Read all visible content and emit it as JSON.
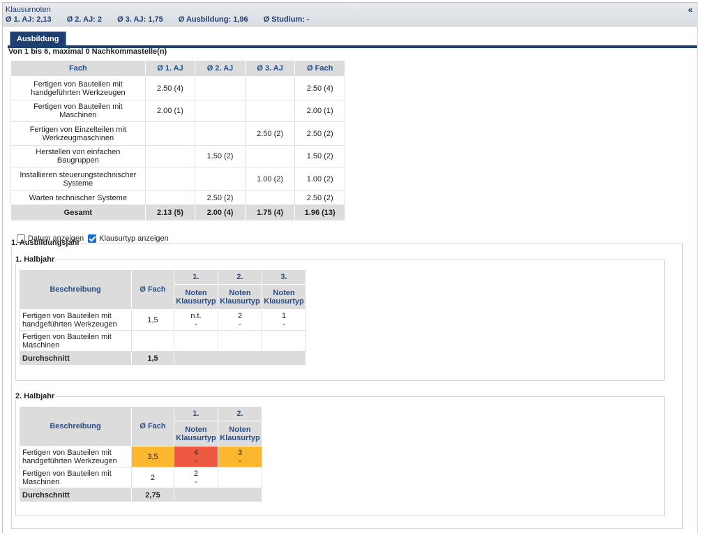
{
  "header": {
    "title": "Klausurnoten",
    "collapse": "«",
    "stats": [
      "Ø 1. AJ: 2,13",
      "Ø 2. AJ: 2",
      "Ø 3. AJ: 1,75",
      "Ø Ausbildung: 1,96",
      "Ø Studium: -"
    ]
  },
  "tab": {
    "label": "Ausbildung"
  },
  "range_note": "Von 1 bis 6, maximal 0 Nachkommastelle(n)",
  "summary": {
    "headers": [
      "Fach",
      "Ø 1. AJ",
      "Ø 2. AJ",
      "Ø 3. AJ",
      "Ø Fach"
    ],
    "rows": [
      [
        "Fertigen von Bauteilen mit handgeführten Werkzeugen",
        "2.50 (4)",
        "",
        "",
        "2.50 (4)"
      ],
      [
        "Fertigen von Bauteilen mit Maschinen",
        "2.00 (1)",
        "",
        "",
        "2.00 (1)"
      ],
      [
        "Fertigen von Einzelteilen mit Werkzeugmaschinen",
        "",
        "",
        "2.50 (2)",
        "2.50 (2)"
      ],
      [
        "Herstellen von einfachen Baugruppen",
        "",
        "1.50 (2)",
        "",
        "1.50 (2)"
      ],
      [
        "Installieren steuerungstechnischer Systeme",
        "",
        "",
        "1.00 (2)",
        "1.00 (2)"
      ],
      [
        "Warten technischer Systeme",
        "",
        "2.50 (2)",
        "",
        "2.50 (2)"
      ]
    ],
    "total": [
      "Gesamt",
      "2.13 (5)",
      "2.00 (4)",
      "1.75 (4)",
      "1.96 (13)"
    ]
  },
  "options": {
    "show_date": "Datum anzeigen",
    "show_type": "Klausurtyp anzeigen",
    "show_date_checked": false,
    "show_type_checked": true
  },
  "year1": {
    "legend": "1. Ausbildungsjahr",
    "half1": {
      "legend": "1. Halbjahr",
      "col_desc": "Beschreibung",
      "col_avg": "Ø Fach",
      "exams": [
        {
          "num": "1.",
          "label": "Noten Klausurtyp"
        },
        {
          "num": "2.",
          "label": "Noten Klausurtyp"
        },
        {
          "num": "3.",
          "label": "Noten Klausurtyp"
        }
      ],
      "rows": [
        {
          "desc": "Fertigen von Bauteilen mit handgeführten Werkzeugen",
          "avg": "1,5",
          "cells": [
            {
              "grade": "n.t.",
              "type": "-"
            },
            {
              "grade": "2",
              "type": "-"
            },
            {
              "grade": "1",
              "type": "-"
            }
          ]
        },
        {
          "desc": "Fertigen von Bauteilen mit Maschinen",
          "avg": "",
          "cells": [
            {
              "grade": "",
              "type": ""
            },
            {
              "grade": "",
              "type": ""
            },
            {
              "grade": "",
              "type": ""
            }
          ]
        }
      ],
      "avg_label": "Durchschnitt",
      "avg_value": "1,5"
    },
    "half2": {
      "legend": "2. Halbjahr",
      "col_desc": "Beschreibung",
      "col_avg": "Ø Fach",
      "exams": [
        {
          "num": "1.",
          "label": "Noten Klausurtyp"
        },
        {
          "num": "2.",
          "label": "Noten Klausurtyp"
        }
      ],
      "rows": [
        {
          "desc": "Fertigen von Bauteilen mit handgeführten Werkzeugen",
          "avg": "3,5",
          "cells": [
            {
              "grade": "4",
              "type": "-"
            },
            {
              "grade": "3",
              "type": "-"
            }
          ]
        },
        {
          "desc": "Fertigen von Bauteilen mit Maschinen",
          "avg": "2",
          "cells": [
            {
              "grade": "2",
              "type": "-"
            },
            {
              "grade": "",
              "type": ""
            }
          ]
        }
      ],
      "avg_label": "Durchschnitt",
      "avg_value": "2,75"
    }
  },
  "colors": {
    "accent": "#1f3f70",
    "warning": "#fbb82f",
    "danger": "#ec5940",
    "header_bg": "#dcdcdc"
  }
}
